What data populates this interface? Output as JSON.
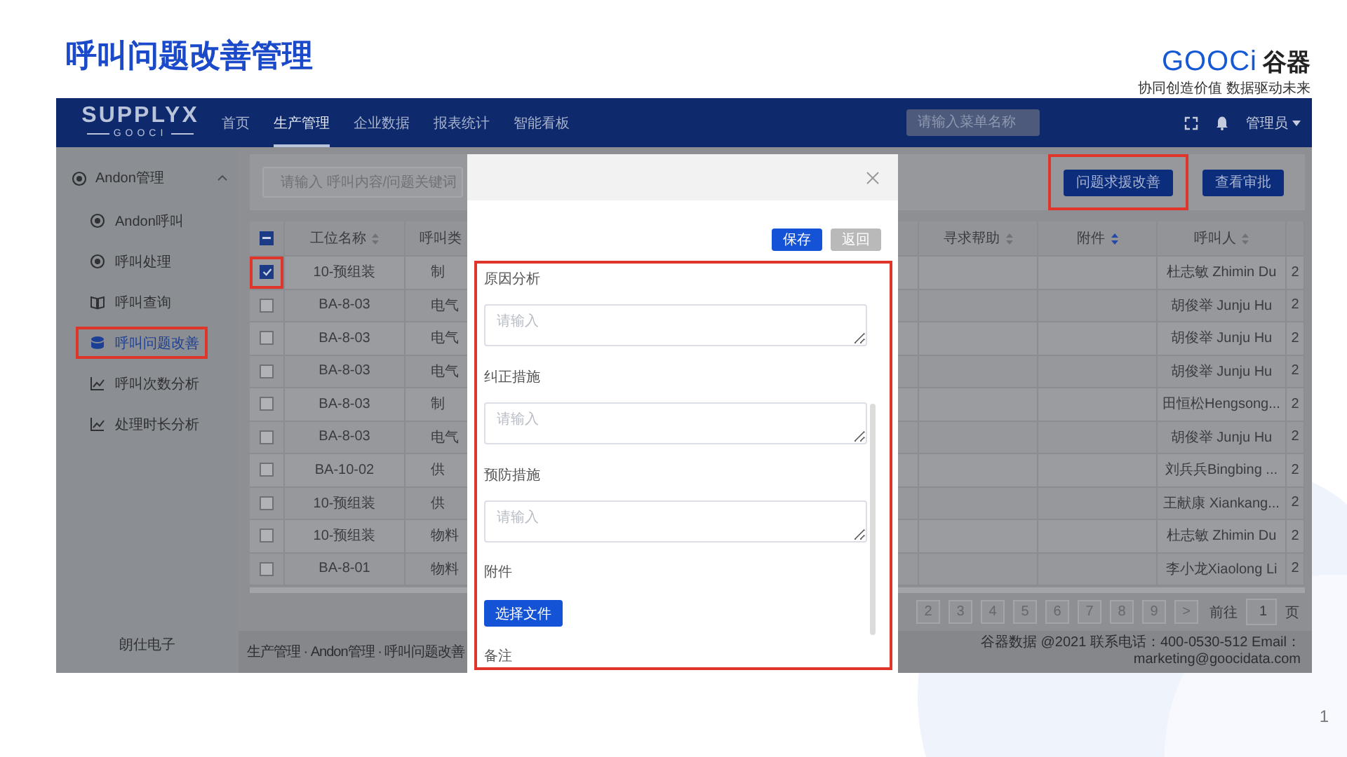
{
  "slide": {
    "title": "呼叫问题改善管理",
    "brand": {
      "latin": "GOOCi",
      "chinese": "谷器",
      "tagline": "协同创造价值 数据驱动未来"
    },
    "page_number": "1"
  },
  "topbar": {
    "logo": {
      "wordmark": "SUPPLYX",
      "subtitle": "GOOCI"
    },
    "menu": [
      {
        "label": "首页",
        "selected": false
      },
      {
        "label": "生产管理",
        "selected": true
      },
      {
        "label": "企业数据",
        "selected": false
      },
      {
        "label": "报表统计",
        "selected": false
      },
      {
        "label": "智能看板",
        "selected": false
      }
    ],
    "search": {
      "placeholder": "请输入菜单名称"
    },
    "user": "管理员"
  },
  "sidebar": {
    "groups": [
      {
        "label": "Andon管理",
        "expanded": true,
        "children": [
          {
            "label": "Andon呼叫",
            "selected": false,
            "highlighted": false
          },
          {
            "label": "呼叫处理",
            "selected": false,
            "highlighted": false
          },
          {
            "label": "呼叫查询",
            "selected": false,
            "highlighted": false
          },
          {
            "label": "呼叫问题改善",
            "selected": true,
            "highlighted": true
          },
          {
            "label": "呼叫次数分析",
            "selected": false,
            "highlighted": false
          },
          {
            "label": "处理时长分析",
            "selected": false,
            "highlighted": false
          }
        ]
      }
    ],
    "footer": "朗仕电子"
  },
  "toolbar": {
    "search": {
      "placeholder": "请输入 呼叫内容/问题关键词"
    },
    "buttons": [
      {
        "label": "问题求援改善",
        "highlighted": true
      },
      {
        "label": "查看审批",
        "highlighted": false
      }
    ]
  },
  "table": {
    "select_all": {
      "indeterminate": true
    },
    "headers": {
      "station": {
        "label": "工位名称",
        "sorted": false
      },
      "call_type": {
        "label": "呼叫类"
      },
      "help": {
        "label": "寻求帮助",
        "sorted": false
      },
      "attachment": {
        "label": "附件",
        "sorted": true
      },
      "caller": {
        "label": "呼叫人",
        "sorted": false
      }
    },
    "rows": [
      {
        "selected": true,
        "highlighted": true,
        "station": "10-预组装",
        "call_type": "制",
        "caller": "杜志敏 Zhimin Du",
        "column_8": "2"
      },
      {
        "selected": false,
        "highlighted": false,
        "station": "BA-8-03",
        "call_type": "电气",
        "caller": "胡俊举 Junju Hu",
        "column_8": "2"
      },
      {
        "selected": false,
        "highlighted": false,
        "station": "BA-8-03",
        "call_type": "电气",
        "caller": "胡俊举 Junju Hu",
        "column_8": "2"
      },
      {
        "selected": false,
        "highlighted": false,
        "station": "BA-8-03",
        "call_type": "电气",
        "caller": "胡俊举 Junju Hu",
        "column_8": "2"
      },
      {
        "selected": false,
        "highlighted": false,
        "station": "BA-8-03",
        "call_type": "制",
        "caller": "田恒松Hengsong...",
        "column_8": "2"
      },
      {
        "selected": false,
        "highlighted": false,
        "station": "BA-8-03",
        "call_type": "电气",
        "caller": "胡俊举 Junju Hu",
        "column_8": "2"
      },
      {
        "selected": false,
        "highlighted": false,
        "station": "BA-10-02",
        "call_type": "供",
        "caller": "刘兵兵Bingbing ...",
        "column_8": "2"
      },
      {
        "selected": false,
        "highlighted": false,
        "station": "10-预组装",
        "call_type": "供",
        "caller": "王献康 Xiankang...",
        "column_8": "2"
      },
      {
        "selected": false,
        "highlighted": false,
        "station": "10-预组装",
        "call_type": "物料",
        "caller": "杜志敏 Zhimin Du",
        "column_8": "2"
      },
      {
        "selected": false,
        "highlighted": false,
        "station": "BA-8-01",
        "call_type": "物料",
        "caller": "李小龙Xiaolong Li",
        "column_8": "2"
      }
    ]
  },
  "pagination": {
    "pages": [
      "2",
      "3",
      "4",
      "5",
      "6",
      "7",
      "8",
      "9"
    ],
    "next": ">",
    "jump_label": "前往",
    "jump_value": "1",
    "jump_unit": "页"
  },
  "footer": {
    "breadcrumb": "生产管理 · Andon管理 · 呼叫问题改善",
    "copyright": "谷器数据 @2021 联系电话：400-0530-512 Email：marketing@goocidata.com"
  },
  "dialog": {
    "buttons": [
      {
        "label": "保存",
        "kind": "primary"
      },
      {
        "label": "返回",
        "kind": "disabled"
      }
    ],
    "form": {
      "highlighted": true,
      "fields": [
        {
          "kind": "textarea",
          "label": "原因分析",
          "placeholder": "请输入"
        },
        {
          "kind": "textarea",
          "label": "纠正措施",
          "placeholder": "请输入"
        },
        {
          "kind": "textarea",
          "label": "预防措施",
          "placeholder": "请输入"
        },
        {
          "kind": "file",
          "label": "附件",
          "button": "选择文件"
        },
        {
          "kind": "label",
          "label": "备注"
        }
      ]
    }
  }
}
